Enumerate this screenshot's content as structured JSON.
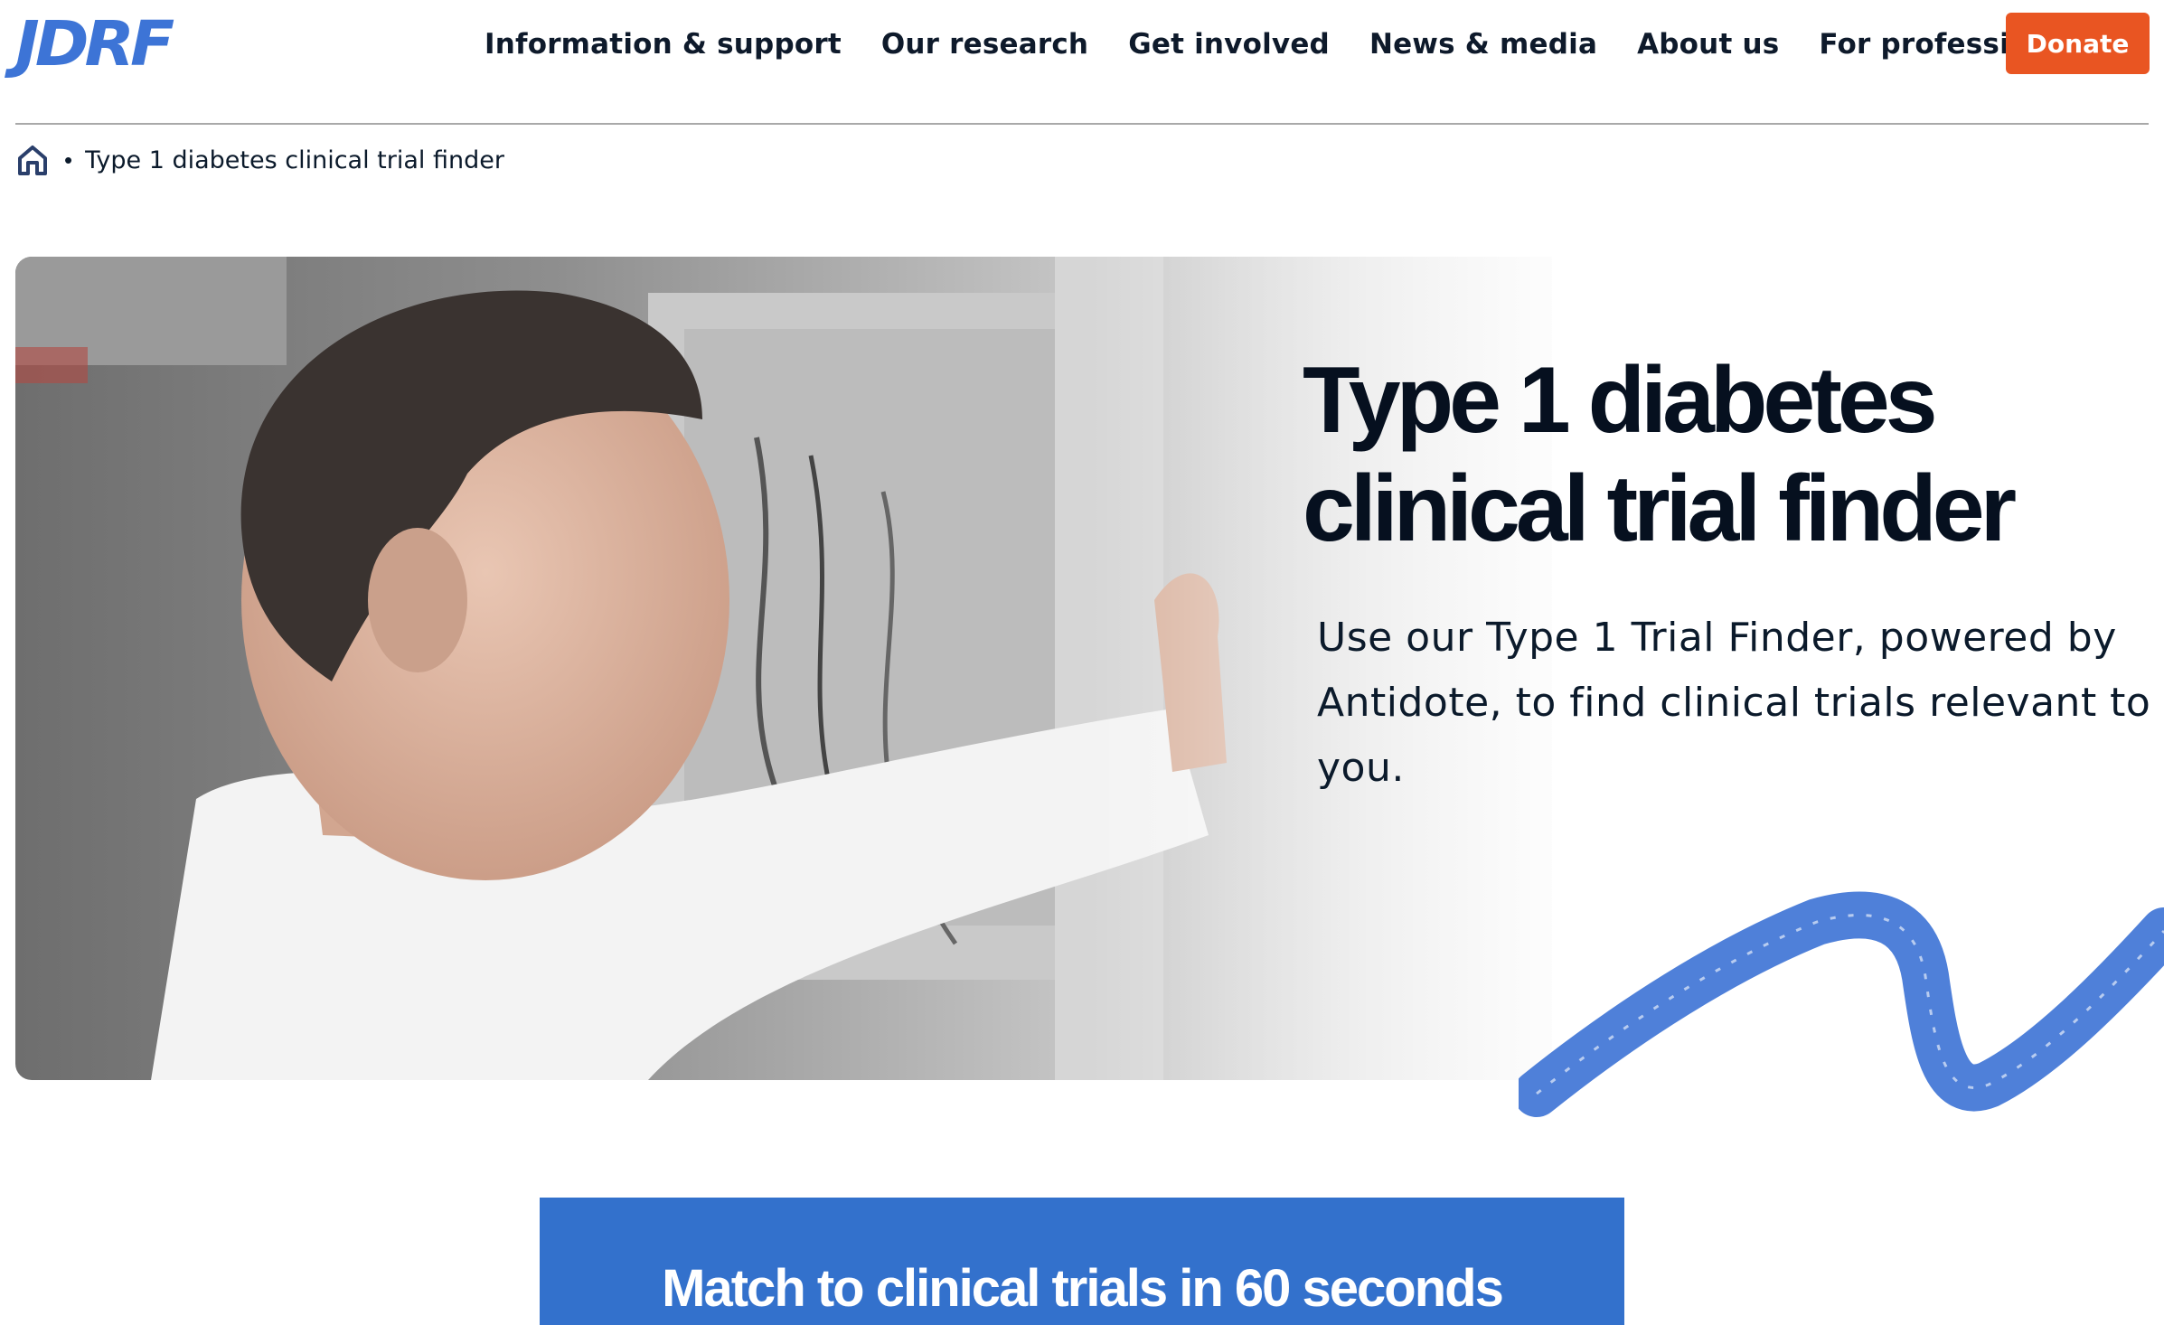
{
  "header": {
    "logo": "JDRF",
    "nav": [
      {
        "label": "Information & support"
      },
      {
        "label": "Our research"
      },
      {
        "label": "Get involved"
      },
      {
        "label": "News & media"
      },
      {
        "label": "About us"
      },
      {
        "label": "For professionals"
      }
    ],
    "donate_label": "Donate",
    "accent_color": "#e95522",
    "brand_color": "#3d74d6"
  },
  "breadcrumb": {
    "home_icon": "home-icon",
    "separator": "•",
    "current": "Type 1 diabetes clinical trial finder"
  },
  "hero": {
    "title_line1": "Type 1 diabetes",
    "title_line2": "clinical trial finder",
    "description": "Use our Type 1 Trial Finder, powered by Antidote, to find clinical trials relevant to you.",
    "squiggle_color": "#4f80d9"
  },
  "match": {
    "title": "Match to clinical trials in 60 seconds",
    "background_color": "#3371cc"
  }
}
